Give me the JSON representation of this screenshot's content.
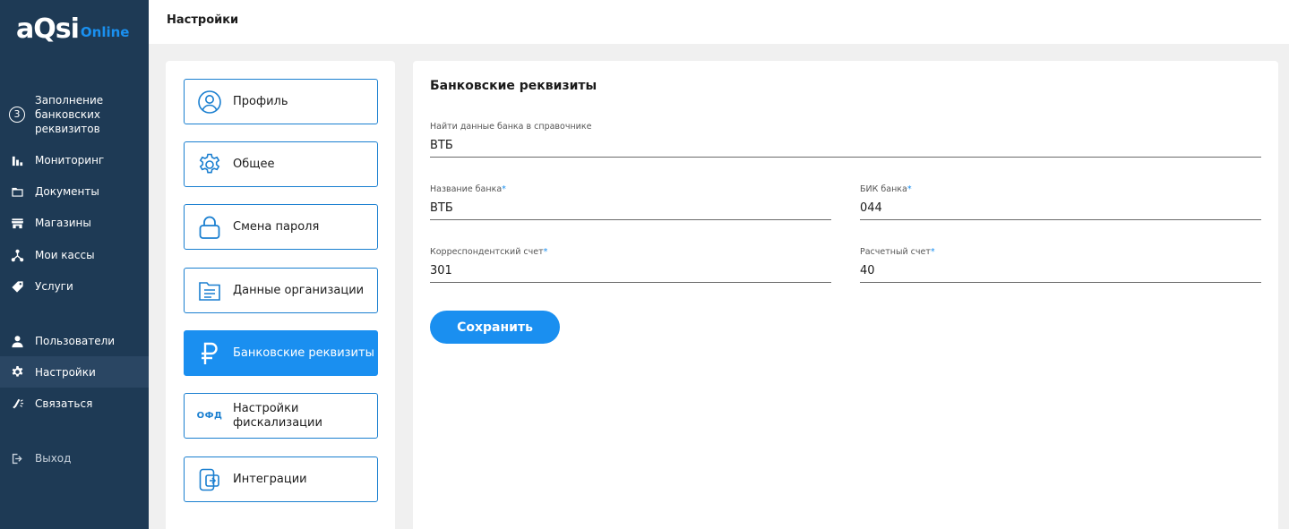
{
  "app": {
    "logo_main": "aQsi",
    "logo_sub": "Online"
  },
  "sidebar": {
    "items": [
      {
        "label": "Заполнение банковских реквизитов",
        "badge": "3",
        "icon": "step-badge"
      },
      {
        "label": "Мониторинг",
        "icon": "bar-chart-icon"
      },
      {
        "label": "Документы",
        "icon": "folder-icon"
      },
      {
        "label": "Магазины",
        "icon": "store-icon"
      },
      {
        "label": "Мои кассы",
        "icon": "network-icon"
      },
      {
        "label": "Услуги",
        "icon": "tag-icon"
      },
      {
        "label": "Пользователи",
        "icon": "user-icon"
      },
      {
        "label": "Настройки",
        "icon": "gear-icon"
      },
      {
        "label": "Связаться",
        "icon": "megaphone-icon"
      },
      {
        "label": "Выход",
        "icon": "logout-icon"
      }
    ]
  },
  "header": {
    "title": "Настройки"
  },
  "settings_menu": {
    "items": [
      {
        "label": "Профиль",
        "icon": "profile-icon"
      },
      {
        "label": "Общее",
        "icon": "gear-icon"
      },
      {
        "label": "Смена пароля",
        "icon": "lock-icon"
      },
      {
        "label": "Данные организации",
        "icon": "document-folder-icon"
      },
      {
        "label": "Банковские реквизиты",
        "icon": "ruble-icon"
      },
      {
        "label": "Настройки фискализации",
        "icon": "ofd-icon",
        "icon_text": "ОФД"
      },
      {
        "label": "Интеграции",
        "icon": "integration-icon"
      }
    ]
  },
  "bank_form": {
    "title": "Банковские реквизиты",
    "search": {
      "label": "Найти данные банка в справочнике",
      "value": "ВТБ"
    },
    "bank_name": {
      "label": "Название банка",
      "value": "ВТБ",
      "required": "*"
    },
    "bik": {
      "label": "БИК банка",
      "value": "044",
      "required": "*"
    },
    "corr_account": {
      "label": "Корреспондентский счет",
      "value": "301",
      "required": "*"
    },
    "settlement_account": {
      "label": "Расчетный счет",
      "value": "40",
      "required": "*"
    },
    "save_label": "Сохранить"
  },
  "colors": {
    "sidebar_bg": "#1e3a55",
    "accent": "#1a8ff0",
    "border": "#1a7fd0"
  }
}
